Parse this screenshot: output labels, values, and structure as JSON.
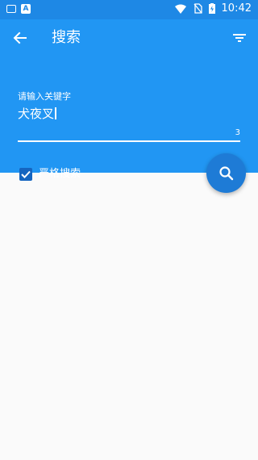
{
  "status_bar": {
    "time": "10:42"
  },
  "header": {
    "title": "搜索"
  },
  "search": {
    "label": "请输入关键字",
    "value": "犬夜叉",
    "counter": "3",
    "strict_label": "严格搜索",
    "strict_checked": true
  },
  "icons": {
    "back": "arrow-left-icon",
    "filter": "filter-icon",
    "fab": "search-icon"
  },
  "colors": {
    "primary": "#2196f3",
    "status_bar": "#1e88e5",
    "fab": "#1e7bd6",
    "background": "#fafafa"
  }
}
